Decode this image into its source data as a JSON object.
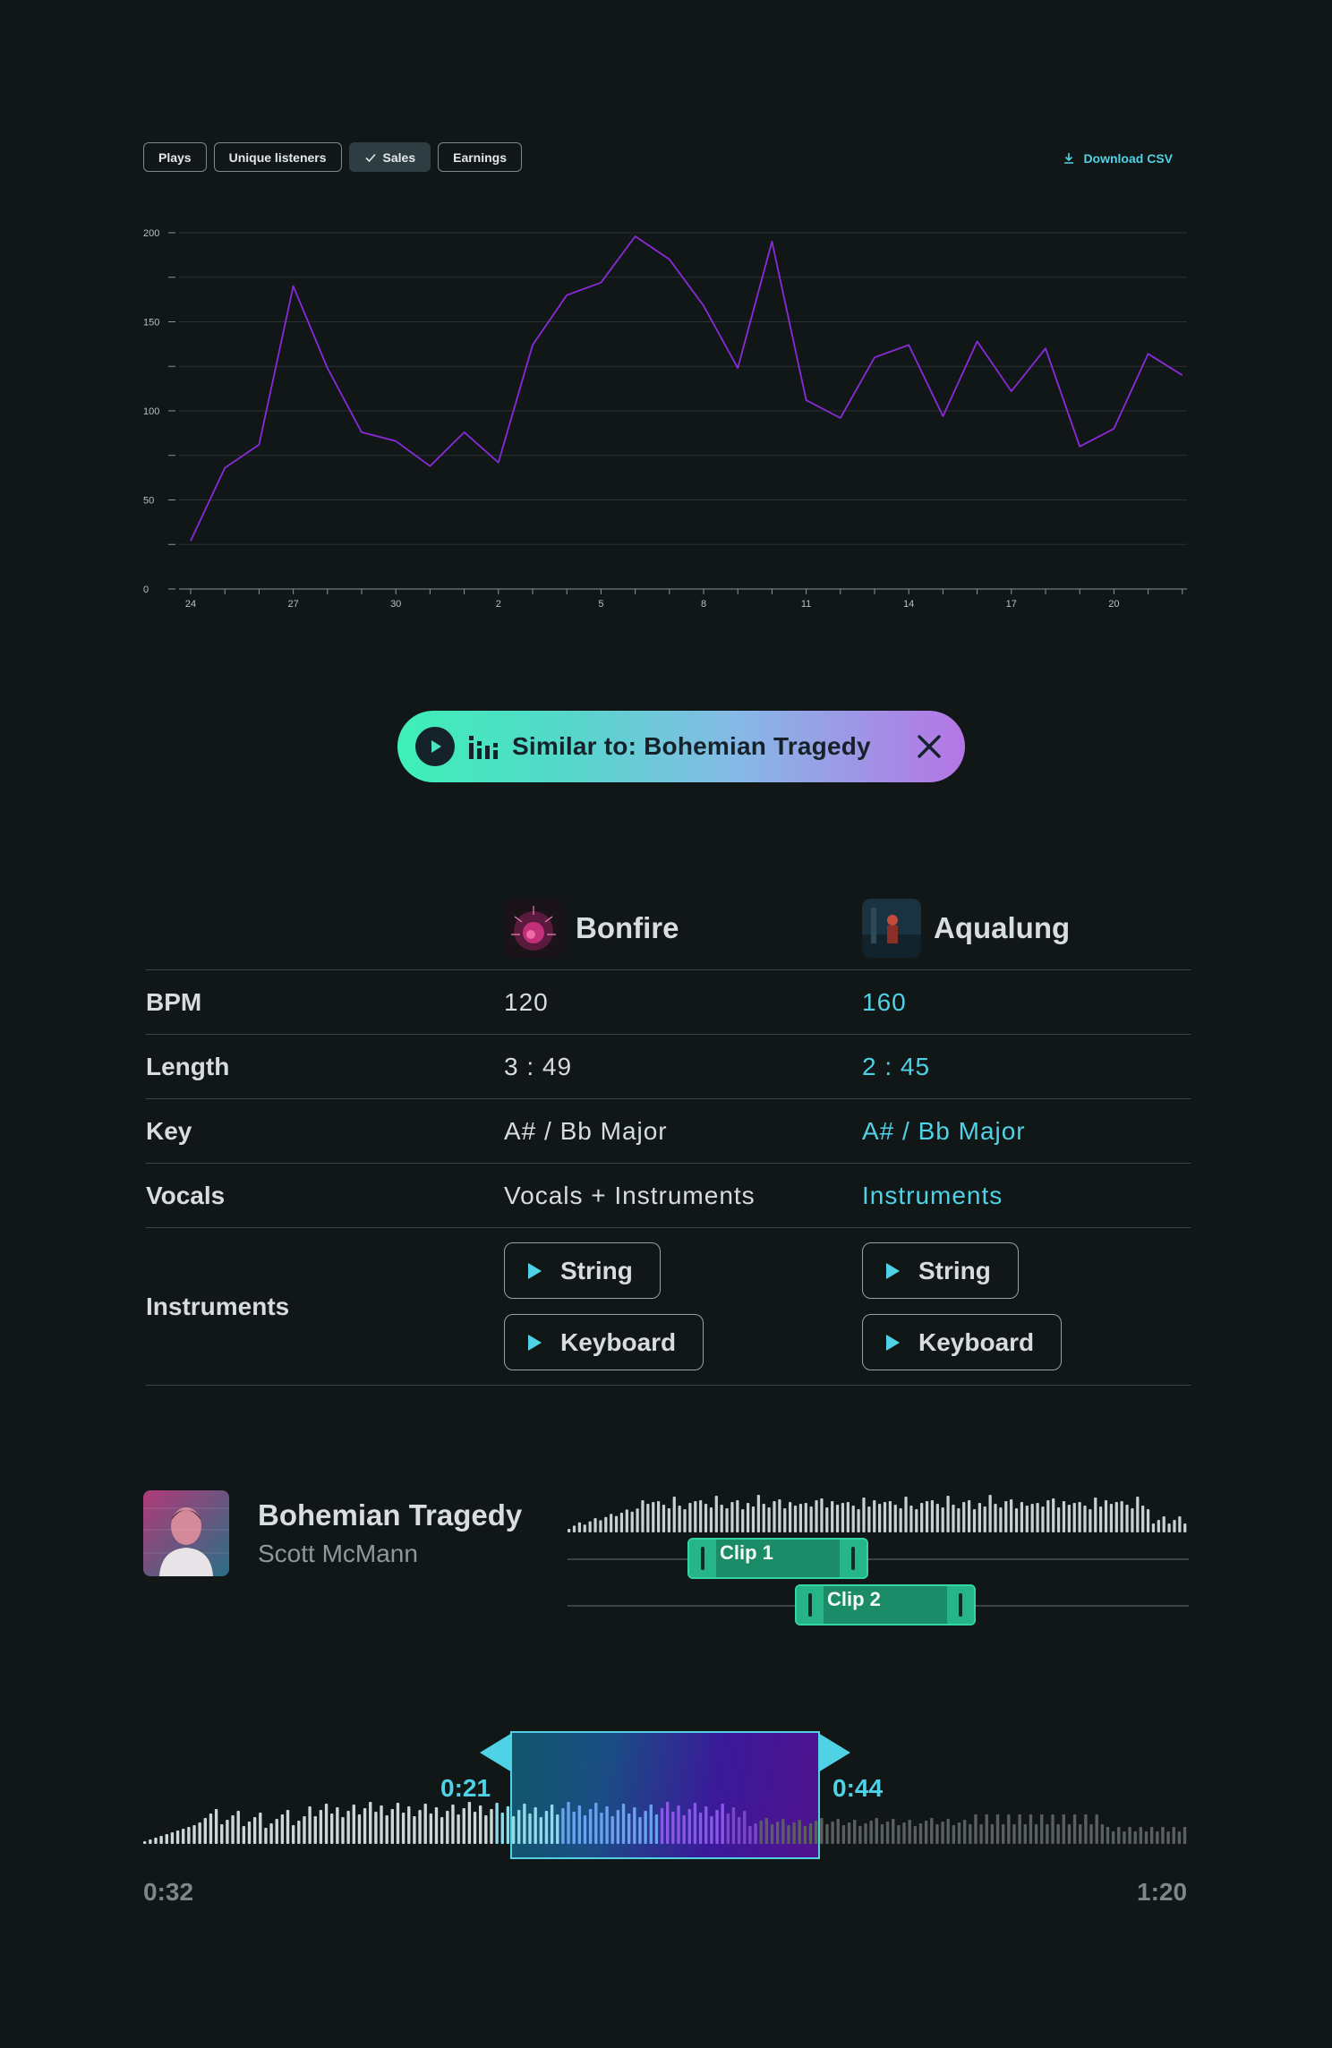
{
  "filters": {
    "chips": [
      {
        "label": "Plays",
        "active": false
      },
      {
        "label": "Unique listeners",
        "active": false
      },
      {
        "label": "Sales",
        "active": true
      },
      {
        "label": "Earnings",
        "active": false
      }
    ],
    "download_label": "Download CSV"
  },
  "chart_data": {
    "type": "line",
    "ylim": [
      0,
      200
    ],
    "y_ticks": [
      0,
      50,
      100,
      150,
      200
    ],
    "x_tick_labels": [
      "24",
      "27",
      "30",
      "2",
      "5",
      "8",
      "11",
      "14",
      "17",
      "20"
    ],
    "series": [
      {
        "values": [
          27,
          68,
          81,
          170,
          124,
          88,
          83,
          69,
          88,
          71,
          137,
          165,
          172,
          198,
          185,
          159,
          124,
          195,
          106,
          96,
          130,
          137,
          97,
          139,
          111,
          135,
          80,
          90,
          132,
          120
        ],
        "color": "#8a2bd8"
      }
    ],
    "grid": true
  },
  "similar": {
    "label": "Similar to: Bohemian Tragedy"
  },
  "compare": {
    "tracks": [
      {
        "name": "Bonfire"
      },
      {
        "name": "Aqualung"
      }
    ],
    "rows": [
      {
        "label": "BPM",
        "a": "120",
        "b": "160"
      },
      {
        "label": "Length",
        "a": "3 : 49",
        "b": "2 : 45"
      },
      {
        "label": "Key",
        "a": "A# / Bb Major",
        "b": "A# / Bb Major"
      },
      {
        "label": "Vocals",
        "a": "Vocals + Instruments",
        "b": "Instruments"
      }
    ],
    "instruments": {
      "label": "Instruments",
      "a": [
        "String",
        "Keyboard"
      ],
      "b": [
        "String",
        "Keyboard"
      ]
    }
  },
  "track": {
    "title": "Bohemian Tragedy",
    "artist": "Scott McMann",
    "clips": [
      "Clip 1",
      "Clip 2"
    ]
  },
  "trimmer": {
    "start_label": "0:21",
    "end_label": "0:44",
    "time_start": "0:32",
    "time_end": "1:20"
  }
}
